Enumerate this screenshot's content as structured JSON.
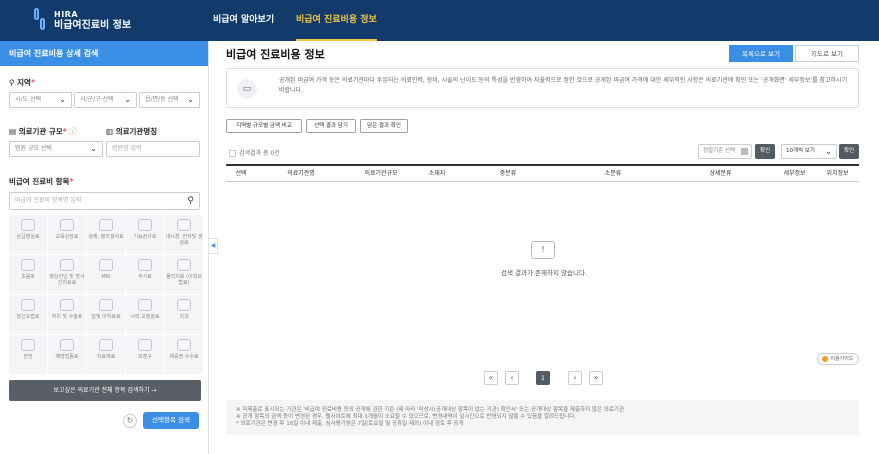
{
  "header": {
    "logo_top": "HIRA",
    "logo_bottom": "비급여진료비 정보",
    "nav": [
      "비급여 알아보기",
      "비급여 진료비용 정보"
    ]
  },
  "left": {
    "title": "비급여 진료비용 상세 검색",
    "region_label": "지역",
    "region_selects": [
      "시/도 선택",
      "시/군/구 선택",
      "읍/면/동 선택"
    ],
    "scale_label": "의료기관 규모",
    "scale_select": "병원 규모 선택",
    "name_label": "의료기관명칭",
    "name_placeholder": "병원명 입력",
    "items_label": "비급여 진료비 항목",
    "items_placeholder": "비급여 진료비 항목명 입력",
    "categories": [
      "상급병실료",
      "교육상담료",
      "검체, 병리검사료",
      "기능검사료",
      "내시경, 천자및 생검료",
      "초음파",
      "영상진단 및 방사선치료료",
      "MRI",
      "주사료",
      "물리치료 (이학요법료)",
      "정신요법료",
      "처치 및 수술료",
      "달빛 마취료료",
      "시력 교정술료",
      "치과",
      "한방",
      "예방접종료",
      "치료재료",
      "보장구",
      "제증명 수수료"
    ],
    "compare_button": "보고싶은 의료기관 전체 항목 검색하기 →",
    "search_button": "선택항목 검색"
  },
  "main": {
    "title": "비급여 진료비용 정보",
    "view_tabs": [
      "목록으로 보기",
      "지도로 보기"
    ],
    "notice": "공개된 비급여 가격 등은 의료기관마다 투입되는 의료인력, 장비, 시술의 난이도 등의 특성을 반영하여 자율적으로 정한 것으로 공개된 비급여 가격에 대한 세부적인 사항은 의료기관에 확인 또는 '공개화면' 세부정보'를 참고하시기 바랍니다.",
    "option_buttons": [
      "지역별·규모별 금액 비교",
      "선택 결과 담기",
      "담은 결과 확인"
    ],
    "result_count": "검색결과 총 0건",
    "sort_select": "정렬기준 선택",
    "sort_button": "확인",
    "page_size_select": "10개씩 보기",
    "page_size_button": "확인",
    "columns": [
      "선택",
      "의료기관명",
      "의료기관규모",
      "소재지",
      "중분류",
      "소분류",
      "상세분류",
      "세부정보",
      "위치정보"
    ],
    "empty_icon": "!",
    "empty_text": "검색 결과가 존재하지 않습니다.",
    "guide": "이용가이드",
    "pagination": {
      "first": "«",
      "prev": "‹",
      "current": "1",
      "next": "›",
      "last": "»"
    },
    "footnotes": [
      "※ 미제출로 표시되는 기관은 '비급여 진료비용 등의 공개에 관한 기준 (제 따라 '미성시(공개대상 항목이 없는 기관) 확인서' 또는 공개대상 항목을 제출하지 않은 의료기관",
      "※ 공개 항목의 금액 등이 변경된 경우, 웹사이트에 최대 1개월이 소요될 수 있으므로, 변경내역이 실시간으로 반영되지 않을 수 있음을 알려드립니다.",
      "* 의료기관은 변경 후 10일 이내 제출, 심사평가원은 7일(토요일 및 공휴일 제외) 이내 검토 후 공개"
    ]
  },
  "colors": {
    "header": "#123a6b",
    "accent": "#3a8ee6",
    "nav_active": "#f2c744"
  }
}
